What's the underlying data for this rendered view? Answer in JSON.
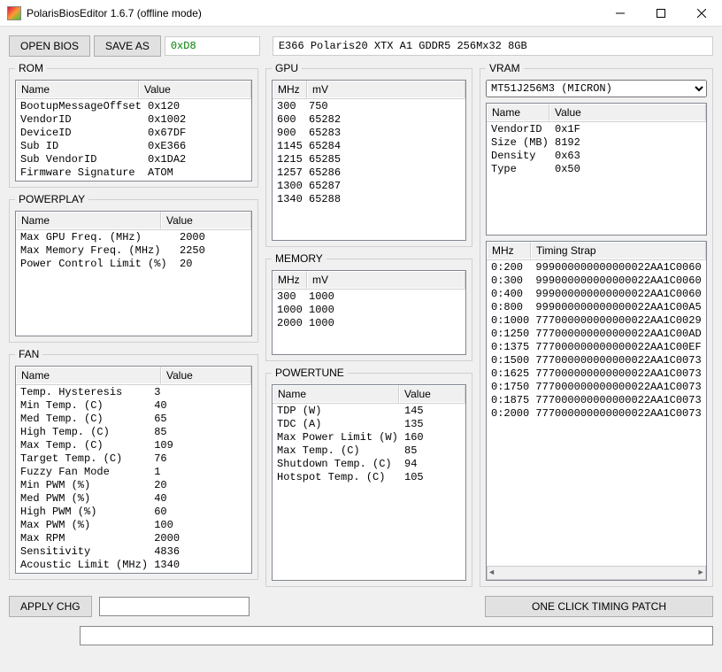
{
  "window": {
    "title": "PolarisBiosEditor 1.6.7 (offline mode)"
  },
  "toolbar": {
    "open_bios": "OPEN BIOS",
    "save_as": "SAVE AS",
    "hex": "0xD8",
    "desc": "E366 Polaris20 XTX A1 GDDR5 256Mx32 8GB",
    "apply_chg": "APPLY CHG",
    "one_click": "ONE CLICK TIMING PATCH"
  },
  "rom": {
    "legend": "ROM",
    "headers": [
      "Name",
      "Value"
    ],
    "rows": [
      [
        "BootupMessageOffset",
        "0x120"
      ],
      [
        "VendorID",
        "0x1002"
      ],
      [
        "DeviceID",
        "0x67DF"
      ],
      [
        "Sub ID",
        "0xE366"
      ],
      [
        "Sub VendorID",
        "0x1DA2"
      ],
      [
        "Firmware Signature",
        "ATOM"
      ]
    ]
  },
  "powerplay": {
    "legend": "POWERPLAY",
    "headers": [
      "Name",
      "Value"
    ],
    "rows": [
      [
        "Max GPU Freq. (MHz)",
        "2000"
      ],
      [
        "Max Memory Freq. (MHz)",
        "2250"
      ],
      [
        "Power Control Limit (%)",
        "20"
      ]
    ]
  },
  "fan": {
    "legend": "FAN",
    "headers": [
      "Name",
      "Value"
    ],
    "rows": [
      [
        "Temp. Hysteresis",
        "3"
      ],
      [
        "Min Temp. (C)",
        "40"
      ],
      [
        "Med Temp. (C)",
        "65"
      ],
      [
        "High Temp. (C)",
        "85"
      ],
      [
        "Max Temp. (C)",
        "109"
      ],
      [
        "Target Temp. (C)",
        "76"
      ],
      [
        "Fuzzy Fan Mode",
        "1"
      ],
      [
        "Min PWM (%)",
        "20"
      ],
      [
        "Med PWM (%)",
        "40"
      ],
      [
        "High PWM (%)",
        "60"
      ],
      [
        "Max PWM (%)",
        "100"
      ],
      [
        "Max RPM",
        "2000"
      ],
      [
        "Sensitivity",
        "4836"
      ],
      [
        "Acoustic Limit (MHz)",
        "1340"
      ]
    ]
  },
  "gpu": {
    "legend": "GPU",
    "headers": [
      "MHz",
      "mV"
    ],
    "rows": [
      [
        "300",
        "750"
      ],
      [
        "600",
        "65282"
      ],
      [
        "900",
        "65283"
      ],
      [
        "1145",
        "65284"
      ],
      [
        "1215",
        "65285"
      ],
      [
        "1257",
        "65286"
      ],
      [
        "1300",
        "65287"
      ],
      [
        "1340",
        "65288"
      ]
    ]
  },
  "memory": {
    "legend": "MEMORY",
    "headers": [
      "MHz",
      "mV"
    ],
    "rows": [
      [
        "300",
        "1000"
      ],
      [
        "1000",
        "1000"
      ],
      [
        "2000",
        "1000"
      ]
    ]
  },
  "powertune": {
    "legend": "POWERTUNE",
    "headers": [
      "Name",
      "Value"
    ],
    "rows": [
      [
        "TDP (W)",
        "145"
      ],
      [
        "TDC (A)",
        "135"
      ],
      [
        "Max Power Limit (W)",
        "160"
      ],
      [
        "Max Temp. (C)",
        "85"
      ],
      [
        "Shutdown Temp. (C)",
        "94"
      ],
      [
        "Hotspot Temp. (C)",
        "105"
      ]
    ]
  },
  "vram": {
    "legend": "VRAM",
    "selected": "MT51J256M3 (MICRON)",
    "headers": [
      "Name",
      "Value"
    ],
    "rows": [
      [
        "VendorID",
        "0x1F"
      ],
      [
        "Size (MB)",
        "8192"
      ],
      [
        "Density",
        "0x63"
      ],
      [
        "Type",
        "0x50"
      ]
    ]
  },
  "timings": {
    "headers": [
      "MHz",
      "Timing Strap"
    ],
    "rows": [
      [
        "0:200",
        "999000000000000022AA1C0060"
      ],
      [
        "0:300",
        "999000000000000022AA1C0060"
      ],
      [
        "0:400",
        "999000000000000022AA1C0060"
      ],
      [
        "0:800",
        "999000000000000022AA1C00A5"
      ],
      [
        "0:1000",
        "777000000000000022AA1C0029"
      ],
      [
        "0:1250",
        "777000000000000022AA1C00AD"
      ],
      [
        "0:1375",
        "777000000000000022AA1C00EF"
      ],
      [
        "0:1500",
        "777000000000000022AA1C0073"
      ],
      [
        "0:1625",
        "777000000000000022AA1C0073"
      ],
      [
        "0:1750",
        "777000000000000022AA1C0073"
      ],
      [
        "0:1875",
        "777000000000000022AA1C0073"
      ],
      [
        "0:2000",
        "777000000000000022AA1C0073"
      ]
    ]
  }
}
